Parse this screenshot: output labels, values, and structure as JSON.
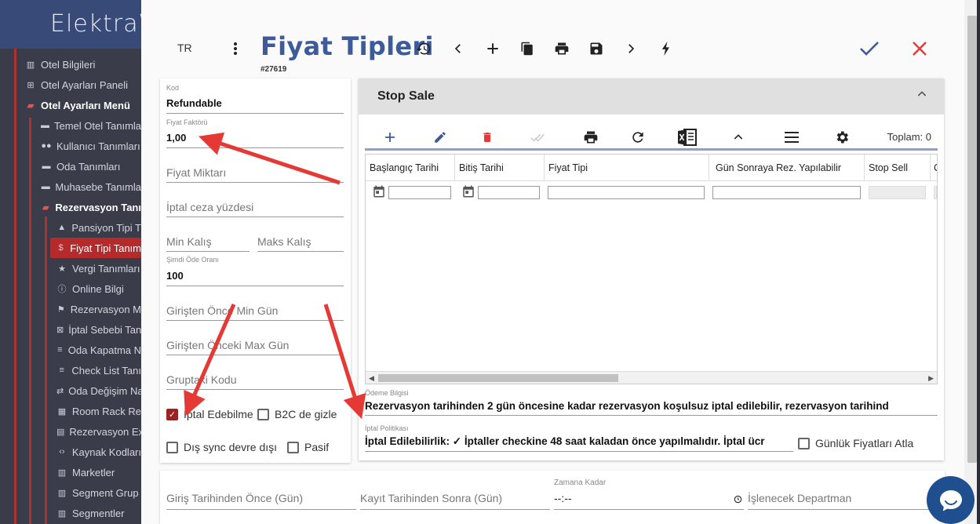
{
  "sidebar": {
    "brand": "ElektraW",
    "items": [
      {
        "label": "Otel Bilgileri",
        "icon": "bank-icon",
        "level": 0
      },
      {
        "label": "Otel Ayarları Paneli",
        "icon": "plus-square-icon",
        "level": 0
      },
      {
        "label": "Otel Ayarları Menü",
        "icon": "folder-open-icon",
        "level": 0,
        "bold": true
      },
      {
        "label": "Temel Otel Tanımla",
        "icon": "folder-icon",
        "level": 1
      },
      {
        "label": "Kullanıcı Tanımları",
        "icon": "users-icon",
        "level": 1
      },
      {
        "label": "Oda Tanımları",
        "icon": "folder-icon",
        "level": 1
      },
      {
        "label": "Muhasebe Tanımla",
        "icon": "folder-icon",
        "level": 1
      },
      {
        "label": "Rezervasyon Tanı",
        "icon": "folder-open-icon",
        "level": 1,
        "bold": true
      },
      {
        "label": "Pansiyon Tipi T",
        "icon": "triangle-icon",
        "level": 2
      },
      {
        "label": "Fiyat Tipi Tanım",
        "icon": "dollar-icon",
        "level": 2,
        "active": true
      },
      {
        "label": "Vergi Tanımları",
        "icon": "star-icon",
        "level": 2
      },
      {
        "label": "Online Bilgi",
        "icon": "info-icon",
        "level": 2
      },
      {
        "label": "Rezervasyon M",
        "icon": "sign-icon",
        "level": 2
      },
      {
        "label": "İptal Sebebi Tan",
        "icon": "cancel-icon",
        "level": 2
      },
      {
        "label": "Oda Kapatma N",
        "icon": "checklist-icon",
        "level": 2
      },
      {
        "label": "Check List Tanı",
        "icon": "checklist-icon",
        "level": 2
      },
      {
        "label": "Oda Değişim Na",
        "icon": "swap-icon",
        "level": 2
      },
      {
        "label": "Room Rack Re",
        "icon": "grid-icon",
        "level": 2
      },
      {
        "label": "Rezervasyon Ex",
        "icon": "table-icon",
        "level": 2
      },
      {
        "label": "Kaynak Kodları",
        "icon": "code-icon",
        "level": 2
      },
      {
        "label": "Marketler",
        "icon": "store-icon",
        "level": 2
      },
      {
        "label": "Segment Grup",
        "icon": "store-icon",
        "level": 2
      },
      {
        "label": "Segmentler",
        "icon": "store-icon",
        "level": 2
      }
    ]
  },
  "toolbar": {
    "lang": "TR",
    "title": "Fiyat Tipleri",
    "record_id": "#27619"
  },
  "form": {
    "kod_label": "Kod",
    "kod_value": "Refundable",
    "faktor_label": "Fiyat Faktörü",
    "faktor_value": "1,00",
    "miktar_placeholder": "Fiyat Miktarı",
    "iptal_ceza_placeholder": "İptal ceza yüzdesi",
    "min_kalis_placeholder": "Min Kalış",
    "maks_kalis_placeholder": "Maks Kalış",
    "simdi_ode_label": "Şimdi Öde Oranı",
    "simdi_ode_value": "100",
    "giristen_min_placeholder": "Girişten Önce Min Gün",
    "giristen_max_placeholder": "Girişten Önceki Max Gün",
    "grup_kodu_placeholder": "Gruptaki Kodu",
    "iptal_edilebilme_label": "İptal Edebilme",
    "iptal_edilebilme_checked": true,
    "b2c_label": "B2C de gizle",
    "dis_sync_label": "Dış sync devre dışı",
    "pasif_label": "Pasif"
  },
  "panel": {
    "title": "Stop Sale",
    "total_label": "Toplam: 0",
    "columns": [
      "Başlangıç Tarihi",
      "Bitiş Tarihi",
      "Fiyat Tipi",
      "Gün Sonraya Rez. Yapılabilir",
      "Stop Sell",
      "C"
    ],
    "odeme_label": "Ödeme Bilgisi",
    "odeme_value": "Rezervasyon tarihinden 2 gün öncesine kadar rezervasyon koşulsuz iptal edilebilir, rezervasyon tarihind",
    "iptal_politikasi_label": "İptal Politikası",
    "iptal_politikasi_value": "İptal Edilebilirlik: ✓ İptaller checkine 48 saat kaladan önce yapılmalıdır. İptal ücr",
    "gunluk_label": "Günlük Fiyatları Atla"
  },
  "bottom": {
    "giris_placeholder": "Giriş Tarihinden Önce (Gün)",
    "kayit_placeholder": "Kayıt Tarihinden Sonra (Gün)",
    "zamana_label": "Zamana Kadar",
    "zamana_value": "--:--",
    "departman_placeholder": "İşlenecek Departman"
  },
  "colors": {
    "title": "#3d5a99",
    "confirm": "#3d5a99",
    "close": "#e53935",
    "delete": "#e53935",
    "add": "#3d5a99",
    "annotation": "#e53935",
    "checkbox_on": "#9b2222"
  }
}
